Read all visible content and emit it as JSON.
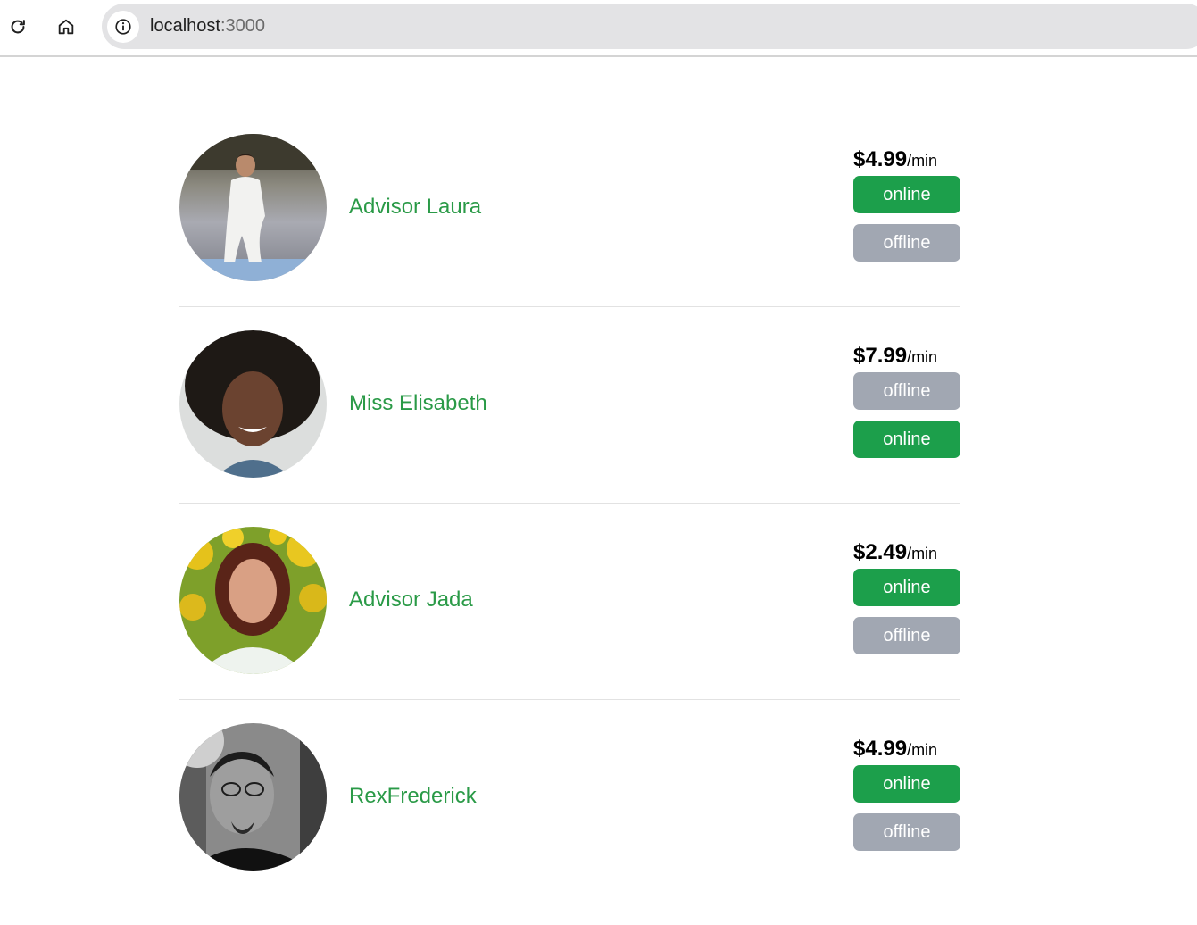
{
  "browser": {
    "url_host": "localhost",
    "url_port": ":3000"
  },
  "advisors": [
    {
      "name": "Advisor Laura",
      "price": "$4.99",
      "unit": "/min",
      "buttons": [
        {
          "label": "online",
          "status": "online"
        },
        {
          "label": "offline",
          "status": "offline"
        }
      ]
    },
    {
      "name": "Miss Elisabeth",
      "price": "$7.99",
      "unit": "/min",
      "buttons": [
        {
          "label": "offline",
          "status": "offline"
        },
        {
          "label": "online",
          "status": "online"
        }
      ]
    },
    {
      "name": "Advisor Jada",
      "price": "$2.49",
      "unit": "/min",
      "buttons": [
        {
          "label": "online",
          "status": "online"
        },
        {
          "label": "offline",
          "status": "offline"
        }
      ]
    },
    {
      "name": "RexFrederick",
      "price": "$4.99",
      "unit": "/min",
      "buttons": [
        {
          "label": "online",
          "status": "online"
        },
        {
          "label": "offline",
          "status": "offline"
        }
      ]
    }
  ],
  "colors": {
    "name_green": "#2a9a47",
    "online_button": "#1c9f4b",
    "offline_button": "#a1a7b2"
  },
  "icons": {
    "reload": "reload-icon",
    "home": "home-icon",
    "site_info": "info-icon"
  }
}
